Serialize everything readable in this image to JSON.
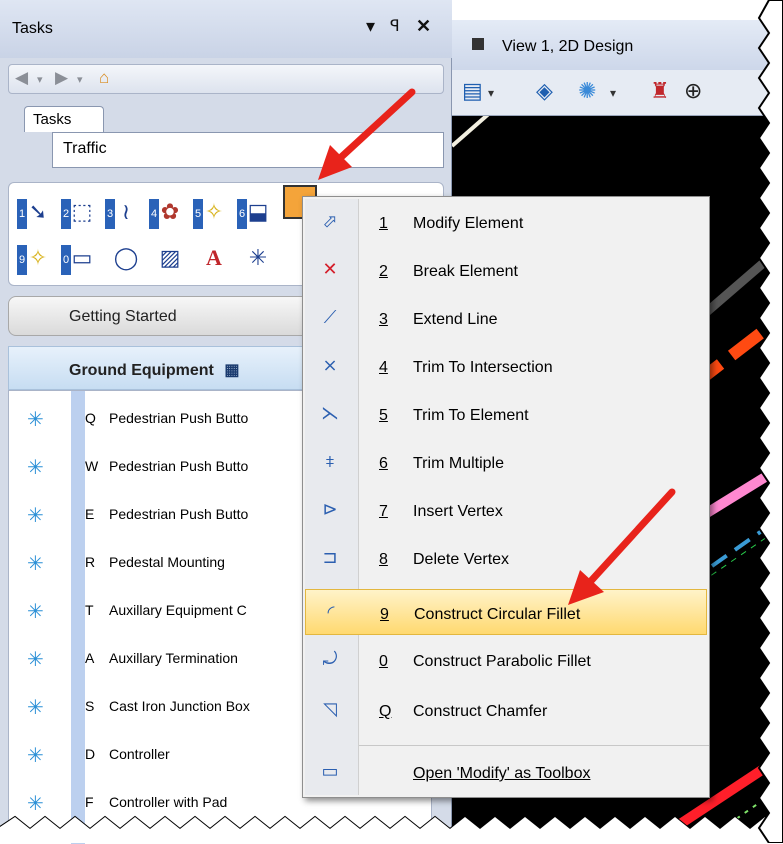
{
  "panel": {
    "title": "Tasks",
    "ctrl_pin": "▾ ꟼ",
    "ctrl_close": "✕",
    "tab_label": "Tasks",
    "traffic_label": "Traffic"
  },
  "toolbar_nums": [
    "1",
    "2",
    "3",
    "4",
    "5",
    "6",
    "9",
    "0"
  ],
  "getting_started": "Getting Started",
  "ground_header": "Ground Equipment",
  "ground_items": [
    {
      "key": "Q",
      "label": "Pedestrian Push Butto"
    },
    {
      "key": "W",
      "label": "Pedestrian Push Butto"
    },
    {
      "key": "E",
      "label": "Pedestrian Push Butto"
    },
    {
      "key": "R",
      "label": "Pedestal Mounting"
    },
    {
      "key": "T",
      "label": "Auxillary Equipment C"
    },
    {
      "key": "A",
      "label": "Auxillary Termination"
    },
    {
      "key": "S",
      "label": "Cast Iron Junction Box"
    },
    {
      "key": "D",
      "label": "Controller"
    },
    {
      "key": "F",
      "label": "Controller with Pad"
    }
  ],
  "view": {
    "title": "View 1, 2D Design"
  },
  "menu": {
    "items": [
      {
        "acc": "1",
        "label": "Modify Element"
      },
      {
        "acc": "2",
        "label": "Break Element"
      },
      {
        "acc": "3",
        "label": "Extend Line"
      },
      {
        "acc": "4",
        "label": "Trim To Intersection"
      },
      {
        "acc": "5",
        "label": "Trim To Element"
      },
      {
        "acc": "6",
        "label": "Trim Multiple"
      },
      {
        "acc": "7",
        "label": "Insert Vertex"
      },
      {
        "acc": "8",
        "label": "Delete Vertex"
      },
      {
        "acc": "9",
        "label": "Construct Circular Fillet"
      },
      {
        "acc": "0",
        "label": "Construct Parabolic Fillet"
      },
      {
        "acc": "Q",
        "label": "Construct Chamfer"
      }
    ],
    "toolbox_label": "Open 'Modify' as Toolbox"
  },
  "colors": {
    "arrow": "#e8231b",
    "highlight": "#ffd970",
    "list_icon": "#2a8fd6"
  }
}
